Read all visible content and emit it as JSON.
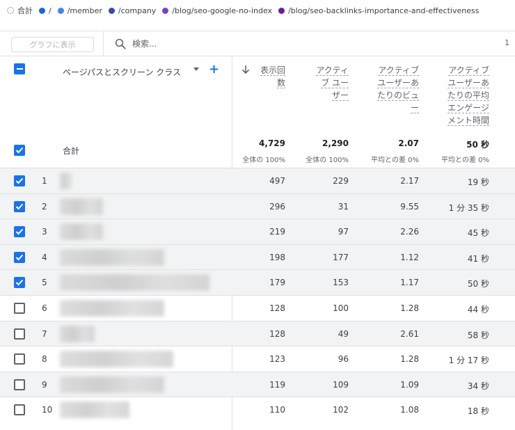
{
  "legend": [
    {
      "label": "合計",
      "color": "#4a74d9",
      "type": "total"
    },
    {
      "label": "/",
      "color": "#1967d2",
      "type": "dot"
    },
    {
      "label": "/member",
      "color": "#4285f4",
      "type": "dot"
    },
    {
      "label": "/company",
      "color": "#3949ab",
      "type": "dot"
    },
    {
      "label": "/blog/seo-google-no-index",
      "color": "#7b3fc7",
      "type": "dot"
    },
    {
      "label": "/blog/seo-backlinks-importance-and-effectiveness",
      "color": "#6a1b9a",
      "type": "dot"
    }
  ],
  "toolbar": {
    "graph_button": "グラフに表示",
    "search_placeholder": "検索...",
    "pager": "1"
  },
  "table": {
    "dimension_header": "ページパスとスクリーン クラス",
    "columns": [
      {
        "label": "表示回数",
        "lines": [
          "表示回",
          "数"
        ],
        "sorted": true
      },
      {
        "label": "アクティブ ユーザー",
        "lines": [
          "アクティ",
          "ブ ユー",
          "ザー"
        ]
      },
      {
        "label": "アクティブ ユーザーあたりのビュー",
        "lines": [
          "アクティブ",
          "ユーザーあ",
          "たりのビュ",
          "ー"
        ]
      },
      {
        "label": "アクティブ ユーザーあたりの平均エンゲージメント時間",
        "lines": [
          "アクティブ",
          "ユーザーあ",
          "たりの平均",
          "エンゲージ",
          "メント時間"
        ]
      }
    ],
    "total": {
      "label": "合計",
      "values": [
        "4,729",
        "2,290",
        "2.07",
        "50 秒"
      ],
      "subs": [
        "全体の 100%",
        "全体の 100%",
        "平均との差 0%",
        "平均との差 0%"
      ]
    },
    "rows": [
      {
        "num": "1",
        "checked": true,
        "values": [
          "497",
          "229",
          "2.17",
          "19 秒"
        ]
      },
      {
        "num": "2",
        "checked": true,
        "values": [
          "296",
          "31",
          "9.55",
          "1 分 35 秒"
        ]
      },
      {
        "num": "3",
        "checked": true,
        "values": [
          "219",
          "97",
          "2.26",
          "45 秒"
        ]
      },
      {
        "num": "4",
        "checked": true,
        "values": [
          "198",
          "177",
          "1.12",
          "41 秒"
        ]
      },
      {
        "num": "5",
        "checked": true,
        "values": [
          "179",
          "153",
          "1.17",
          "50 秒"
        ]
      },
      {
        "num": "6",
        "checked": false,
        "values": [
          "128",
          "100",
          "1.28",
          "44 秒"
        ]
      },
      {
        "num": "7",
        "checked": false,
        "values": [
          "128",
          "49",
          "2.61",
          "58 秒"
        ]
      },
      {
        "num": "8",
        "checked": false,
        "values": [
          "123",
          "96",
          "1.28",
          "1 分 17 秒"
        ]
      },
      {
        "num": "9",
        "checked": false,
        "values": [
          "119",
          "109",
          "1.09",
          "34 秒"
        ]
      },
      {
        "num": "10",
        "checked": false,
        "values": [
          "110",
          "102",
          "1.08",
          "18 秒"
        ]
      }
    ]
  }
}
